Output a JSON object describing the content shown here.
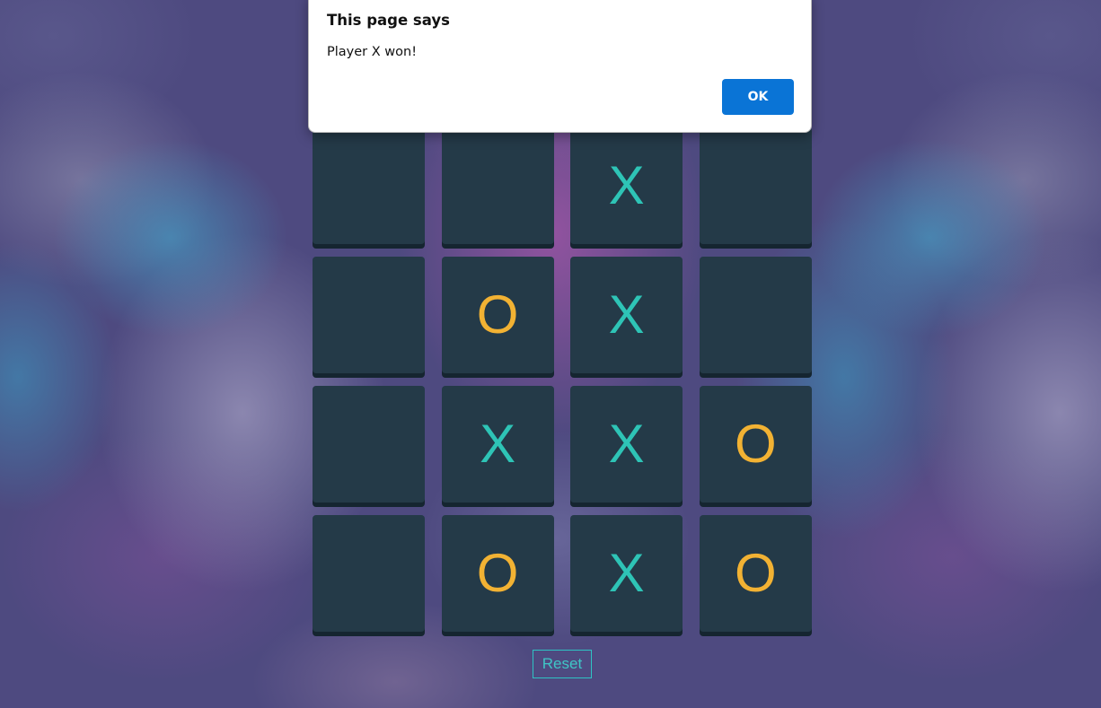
{
  "alert": {
    "title": "This page says",
    "message": "Player X won!",
    "ok_label": "OK"
  },
  "board": {
    "cells": [
      "",
      "",
      "X",
      "",
      "",
      "O",
      "X",
      "",
      "",
      "X",
      "X",
      "O",
      "",
      "O",
      "X",
      "O"
    ],
    "colors": {
      "x": "#2ec4b6",
      "o": "#f2b233",
      "tile": "#243a48"
    }
  },
  "reset_label": "Reset"
}
